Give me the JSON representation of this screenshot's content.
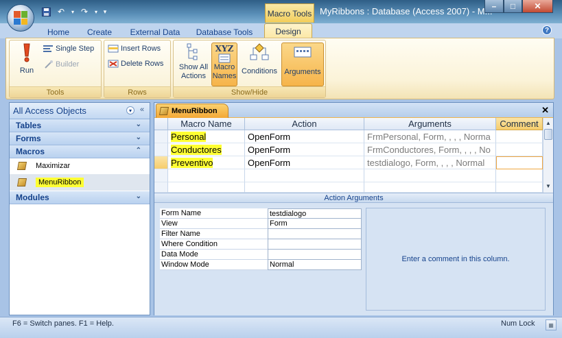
{
  "window": {
    "contextual_tab_label": "Macro Tools",
    "title": "MyRibbons : Database (Access 2007) - M...",
    "controls": {
      "minimize": "–",
      "maximize": "□",
      "close": "✕"
    }
  },
  "qat": {
    "save_icon": "save-icon",
    "undo_icon": "undo-icon",
    "redo_icon": "redo-icon",
    "customize_icon": "chevron-down-icon"
  },
  "tabs": [
    {
      "label": "Home"
    },
    {
      "label": "Create"
    },
    {
      "label": "External Data"
    },
    {
      "label": "Database Tools"
    },
    {
      "label": "Design",
      "selected": true
    }
  ],
  "ribbon": {
    "tools": {
      "label": "Tools",
      "run": "Run",
      "single_step": "Single Step",
      "builder": "Builder"
    },
    "rows": {
      "label": "Rows",
      "insert_rows": "Insert Rows",
      "delete_rows": "Delete Rows"
    },
    "show_hide": {
      "label": "Show/Hide",
      "show_all_actions_1": "Show All",
      "show_all_actions_2": "Actions",
      "macro_names_1": "Macro",
      "macro_names_2": "Names",
      "conditions": "Conditions",
      "arguments": "Arguments",
      "xyz": "XYZ"
    }
  },
  "nav": {
    "header": "All Access Objects",
    "sections": {
      "tables": "Tables",
      "forms": "Forms",
      "macros": "Macros",
      "modules": "Modules"
    },
    "macro_items": [
      "Maximizar",
      "MenuRibbon"
    ]
  },
  "document": {
    "tab_label": "MenuRibbon",
    "columns": [
      "Macro Name",
      "Action",
      "Arguments",
      "Comment"
    ],
    "rows": [
      {
        "macro_name": "Personal",
        "action": "OpenForm",
        "arguments": "FrmPersonal, Form, , , , Norma",
        "comment": ""
      },
      {
        "macro_name": "Conductores",
        "action": "OpenForm",
        "arguments": "FrmConductores, Form, , , , No",
        "comment": ""
      },
      {
        "macro_name": "Preventivo",
        "action": "OpenForm",
        "arguments": "testdialogo, Form, , , , Normal",
        "comment": ""
      }
    ],
    "action_arguments_title": "Action Arguments",
    "arguments": [
      {
        "label": "Form Name",
        "value": "testdialogo"
      },
      {
        "label": "View",
        "value": "Form"
      },
      {
        "label": "Filter Name",
        "value": ""
      },
      {
        "label": "Where Condition",
        "value": ""
      },
      {
        "label": "Data Mode",
        "value": ""
      },
      {
        "label": "Window Mode",
        "value": "Normal"
      }
    ],
    "hint": "Enter a comment in this column."
  },
  "status": {
    "left": "F6 = Switch panes.  F1 = Help.",
    "right": "Num Lock"
  },
  "colors": {
    "highlight": "#ffff33",
    "accent": "#f6b44a",
    "ribbon_text": "#15428b"
  }
}
